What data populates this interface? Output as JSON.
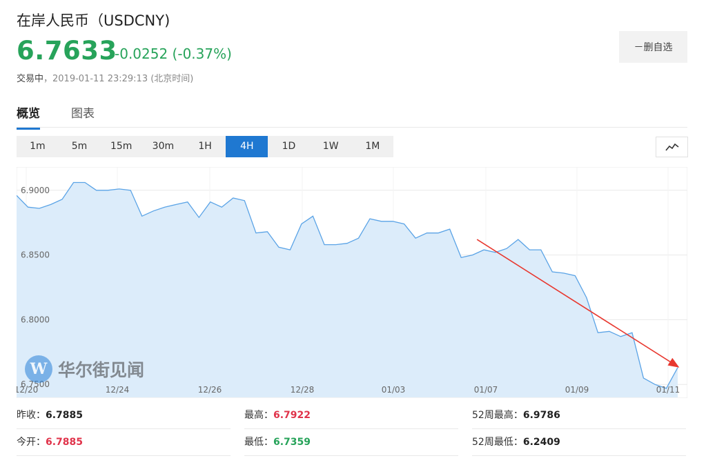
{
  "header": {
    "title": "在岸人民币（USDCNY)",
    "price": "6.7633",
    "change": "-0.0252 (-0.37%)",
    "status": "交易中",
    "timestamp": "，2019-01-11 23:29:13 (北京时间)",
    "delete_button": "－删自选"
  },
  "tabs": [
    {
      "label": "概览",
      "active": true
    },
    {
      "label": "图表",
      "active": false
    }
  ],
  "periods": [
    {
      "label": "1m"
    },
    {
      "label": "5m"
    },
    {
      "label": "15m"
    },
    {
      "label": "30m"
    },
    {
      "label": "1H"
    },
    {
      "label": "4H",
      "active": true
    },
    {
      "label": "1D"
    },
    {
      "label": "1W"
    },
    {
      "label": "1M"
    }
  ],
  "chart_type_icon": "line-chart-icon",
  "watermark": {
    "logo_letter": "W",
    "text": "华尔街见闻"
  },
  "chart_data": {
    "type": "area",
    "ylim": [
      6.74,
      6.918
    ],
    "y_ticks": [
      "6.9000",
      "6.8500",
      "6.8000",
      "6.7500"
    ],
    "x_tick_labels": [
      "12/20",
      "12/24",
      "12/26",
      "12/28",
      "01/03",
      "01/07",
      "01/09",
      "01/11"
    ],
    "series": [
      {
        "values": [
          6.896,
          6.887,
          6.886,
          6.889,
          6.893,
          6.906,
          6.906,
          6.9,
          6.9,
          6.901,
          6.9,
          6.88,
          6.884,
          6.887,
          6.889,
          6.891,
          6.879,
          6.891,
          6.887,
          6.894,
          6.892,
          6.867,
          6.868,
          6.856,
          6.854,
          6.874,
          6.88,
          6.858,
          6.858,
          6.859,
          6.863,
          6.878,
          6.876,
          6.876,
          6.874,
          6.863,
          6.867,
          6.867,
          6.87,
          6.848,
          6.85,
          6.854,
          6.852,
          6.855,
          6.862,
          6.854,
          6.854,
          6.837,
          6.836,
          6.834,
          6.817,
          6.79,
          6.791,
          6.787,
          6.79,
          6.755,
          6.75,
          6.747,
          6.763
        ]
      }
    ],
    "annotation": {
      "type": "arrow",
      "color": "#e8382f",
      "start_index": 41,
      "start_value": 6.862,
      "end_index": 58,
      "end_value": 6.7635
    },
    "colors": {
      "line": "#5aa3e6",
      "fill": "#dcecfa",
      "grid": "#e9e9e9"
    }
  },
  "stats": [
    [
      {
        "label": "昨收：",
        "value": "6.7885",
        "color": "dark"
      },
      {
        "label": "最高：",
        "value": "6.7922",
        "color": "red"
      },
      {
        "label": "52周最高：",
        "value": "6.9786",
        "color": "dark"
      }
    ],
    [
      {
        "label": "今开：",
        "value": "6.7885",
        "color": "red"
      },
      {
        "label": "最低：",
        "value": "6.7359",
        "color": "green"
      },
      {
        "label": "52周最低：",
        "value": "6.2409",
        "color": "dark"
      }
    ]
  ]
}
